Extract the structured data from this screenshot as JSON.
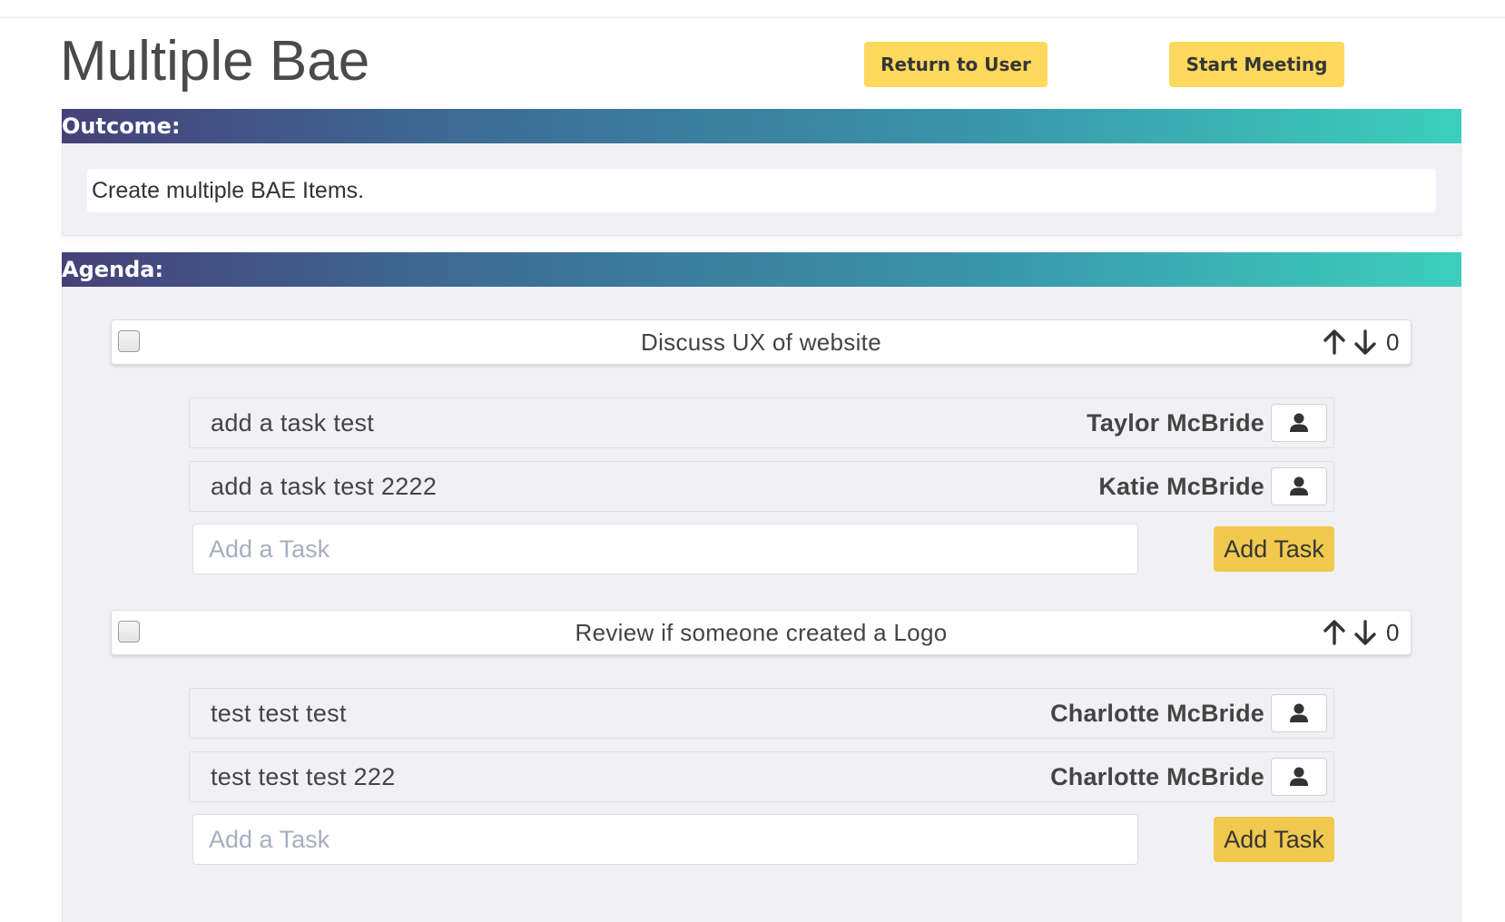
{
  "page": {
    "title": "Multiple Bae",
    "return_button": "Return to User",
    "start_button": "Start Meeting"
  },
  "outcome": {
    "label": "Outcome:",
    "text": "Create multiple BAE Items."
  },
  "agenda": {
    "label": "Agenda:",
    "items": [
      {
        "title": "Discuss UX of website",
        "votes": "0",
        "checked": false,
        "tasks": [
          {
            "text": "add a task test",
            "assignee": "Taylor McBride"
          },
          {
            "text": "add a task test 2222",
            "assignee": "Katie McBride"
          }
        ],
        "input_placeholder": "Add a Task",
        "add_button": "Add Task"
      },
      {
        "title": "Review if someone created a Logo",
        "votes": "0",
        "checked": false,
        "tasks": [
          {
            "text": "test test test",
            "assignee": "Charlotte McBride"
          },
          {
            "text": "test test test 222",
            "assignee": "Charlotte McBride"
          }
        ],
        "input_placeholder": "Add a Task",
        "add_button": "Add Task"
      }
    ]
  },
  "icons": {
    "vote_up": "arrow-up-icon",
    "vote_down": "arrow-down-icon",
    "assign": "user-icon"
  },
  "colors": {
    "button_yellow": "#fed95e",
    "add_task_yellow": "#f0c94e",
    "gradient_start": "#464179",
    "gradient_end": "#3ccfbc",
    "panel_bg": "#f1f1f5"
  }
}
